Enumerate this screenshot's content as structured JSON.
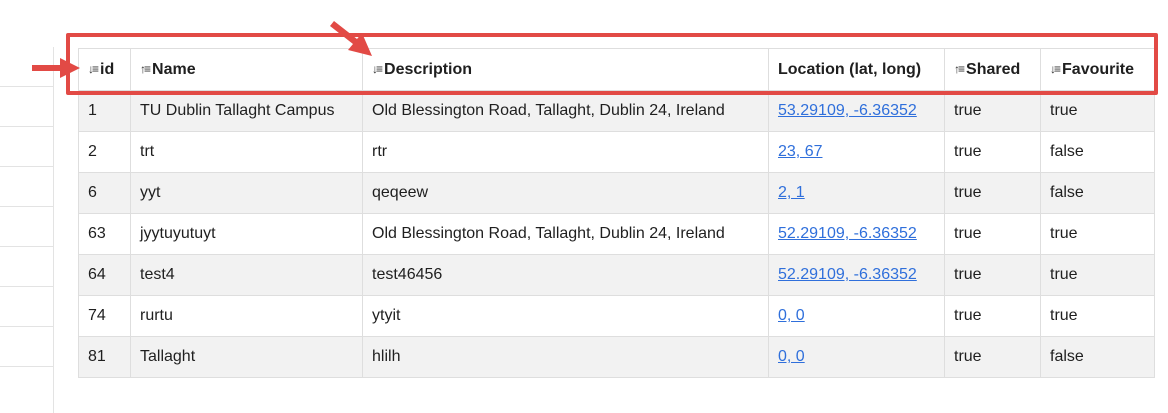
{
  "table": {
    "columns": [
      {
        "label": "id",
        "sort": "desc"
      },
      {
        "label": "Name",
        "sort": "asc"
      },
      {
        "label": "Description",
        "sort": "desc"
      },
      {
        "label": "Location (lat, long)",
        "sort": "none"
      },
      {
        "label": "Shared",
        "sort": "asc"
      },
      {
        "label": "Favourite",
        "sort": "desc"
      }
    ],
    "sort_icons": {
      "asc": "↑≡",
      "desc": "↓≡"
    },
    "rows": [
      {
        "id": "1",
        "name": "TU Dublin Tallaght Campus",
        "description": "Old Blessington Road, Tallaght, Dublin 24, Ireland",
        "location": "53.29109, -6.36352",
        "shared": "true",
        "favourite": "true"
      },
      {
        "id": "2",
        "name": "trt",
        "description": "rtr",
        "location": "23, 67",
        "shared": "true",
        "favourite": "false"
      },
      {
        "id": "6",
        "name": "yyt",
        "description": "qeqeew",
        "location": "2, 1",
        "shared": "true",
        "favourite": "false"
      },
      {
        "id": "63",
        "name": "jyytuyutuyt",
        "description": "Old Blessington Road, Tallaght, Dublin 24, Ireland",
        "location": "52.29109, -6.36352",
        "shared": "true",
        "favourite": "true"
      },
      {
        "id": "64",
        "name": "test4",
        "description": "test46456",
        "location": "52.29109, -6.36352",
        "shared": "true",
        "favourite": "true"
      },
      {
        "id": "74",
        "name": "rurtu",
        "description": "ytyit",
        "location": "0, 0",
        "shared": "true",
        "favourite": "true"
      },
      {
        "id": "81",
        "name": "Tallaght",
        "description": "hlilh",
        "location": "0, 0",
        "shared": "true",
        "favourite": "false"
      }
    ]
  },
  "annotation": {
    "color": "#e24a45",
    "link_color": "#2f6fdb"
  }
}
